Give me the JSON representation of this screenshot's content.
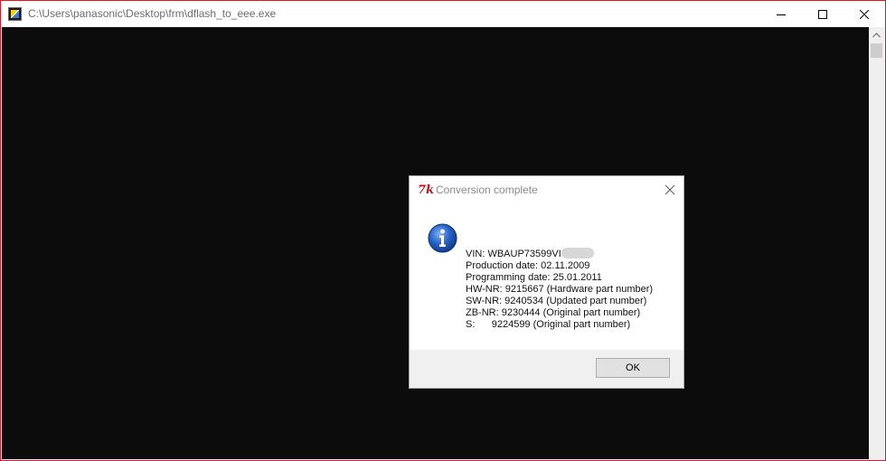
{
  "window": {
    "title": "C:\\Users\\panasonic\\Desktop\\frm\\dflash_to_eee.exe",
    "border_color": "#e81123",
    "console_color": "#0c0c0c"
  },
  "dialog": {
    "icon_label": "7k",
    "title": "Conversion complete",
    "icon": "info-icon",
    "lines": [
      "VIN: WBAUP73599VI",
      "Production date: 02.11.2009",
      "Programming date: 25.01.2011",
      "HW-NR: 9215667 (Hardware part number)",
      "SW-NR: 9240534 (Updated part number)",
      "ZB-NR: 9230444 (Original part number)",
      "S:      9224599 (Original part number)"
    ],
    "ok_label": "OK"
  }
}
